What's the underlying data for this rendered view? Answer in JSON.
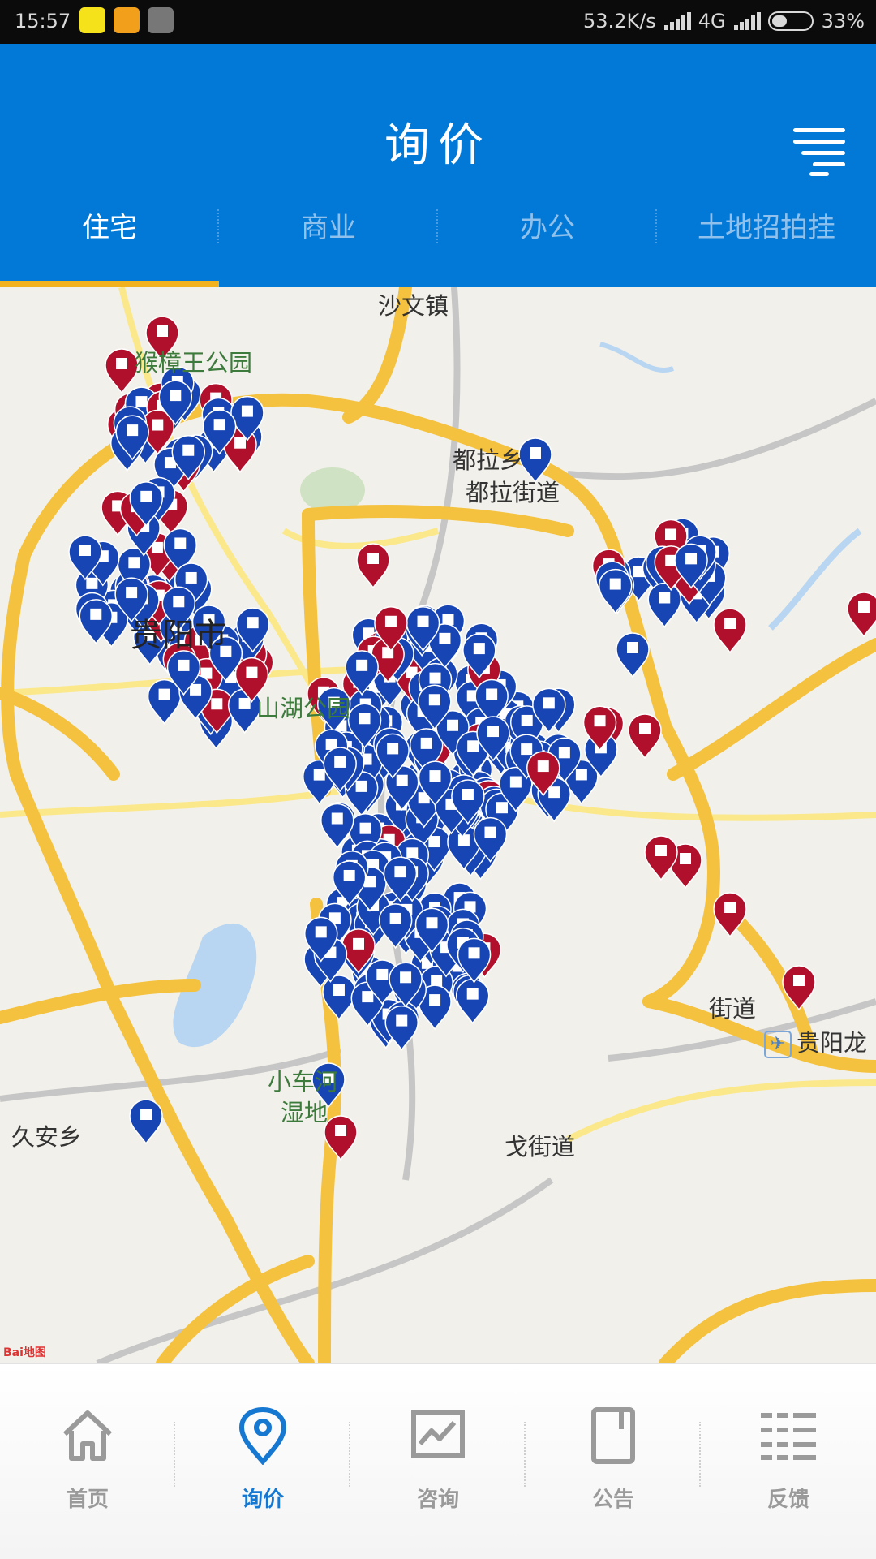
{
  "status_bar": {
    "time": "15:57",
    "speed": "53.2K/s",
    "network": "4G",
    "battery": "33%",
    "battery_level": 0.33
  },
  "header": {
    "title": "询价"
  },
  "tabs": [
    {
      "label": "住宅",
      "active": true
    },
    {
      "label": "商业",
      "active": false
    },
    {
      "label": "办公",
      "active": false
    },
    {
      "label": "土地招拍挂",
      "active": false
    }
  ],
  "map": {
    "labels": {
      "shawen": "沙文镇",
      "hzw_park": "猴樟王公园",
      "dula": "都拉乡",
      "dula_jd": "都拉街道",
      "guiyang": "贵阳市",
      "shanhu_park": "山湖公园",
      "xiaochehe": "小车河",
      "wetland": "湿地",
      "jiuan": "久安乡",
      "xiaomeng_jd": "戈街道",
      "right_jd": "街道",
      "airport": "贵阳龙",
      "baidu": "Bai地图"
    },
    "colors": {
      "blue_pin": "#1745b4",
      "red_pin": "#b0102c",
      "road_major": "#f4c23f",
      "road_minor": "#fbe88a",
      "water": "#b8d6f2",
      "park": "#cfe2c3"
    }
  },
  "bottom_nav": [
    {
      "label": "首页",
      "icon": "home-icon",
      "active": false
    },
    {
      "label": "询价",
      "icon": "location-pin-icon",
      "active": true
    },
    {
      "label": "咨询",
      "icon": "chart-icon",
      "active": false
    },
    {
      "label": "公告",
      "icon": "notebook-icon",
      "active": false
    },
    {
      "label": "反馈",
      "icon": "list-icon",
      "active": false
    }
  ]
}
